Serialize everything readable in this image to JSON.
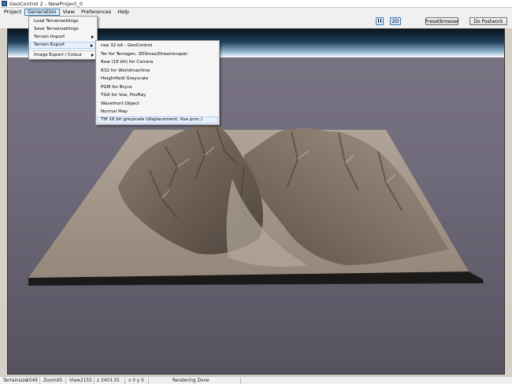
{
  "window": {
    "title": "GeoControl 2  -  NewProject_0"
  },
  "menubar": {
    "items": [
      {
        "label": "Project"
      },
      {
        "label": "Generation"
      },
      {
        "label": "View"
      },
      {
        "label": "Preferences"
      },
      {
        "label": "Help"
      }
    ]
  },
  "toolbar": {
    "btn_2d": "2D",
    "preset_label": "Presetbrowser",
    "postwork_label": "Do Postwork"
  },
  "generation_menu": {
    "items": [
      {
        "label": "Load Terrainsettings"
      },
      {
        "label": "Save Terrainsettings"
      },
      {
        "label": "Terrain Import"
      },
      {
        "label": "Terrain Export"
      },
      {
        "label": "Image Export / Colour"
      }
    ]
  },
  "export_menu": {
    "items": [
      {
        "label": "raw 32 bit - GeoControl"
      },
      {
        "label": "Ter for Terragen, 3DSmax/Dreamscaper"
      },
      {
        "label": "Raw (16 bit)  for Carrara"
      },
      {
        "label": "R32 for Worldmachine"
      },
      {
        "label": "Heightfield Greyscale"
      },
      {
        "label": "PGM for Bryce"
      },
      {
        "label": "TGA for Vue, PovRay"
      },
      {
        "label": "Wavefront Object"
      },
      {
        "label": "Normal Map"
      },
      {
        "label": "Tiff 16 bit greyscale (displacement, Vue proc.)"
      }
    ]
  },
  "statusbar": {
    "terrainsize_label": "Terrainsize",
    "terrainsize_value": "2048",
    "zoom_label": "Zoom",
    "zoom_value": "95",
    "view_label": "View",
    "view_value": "2155",
    "z_label": "z 3403.55",
    "xy_label": "x 0 y 0",
    "status_text": "Rendering Done"
  },
  "colors": {
    "menu_highlight": "#e8f1fb",
    "active_button": "#cfe4fa",
    "terrain": "#a49689"
  }
}
